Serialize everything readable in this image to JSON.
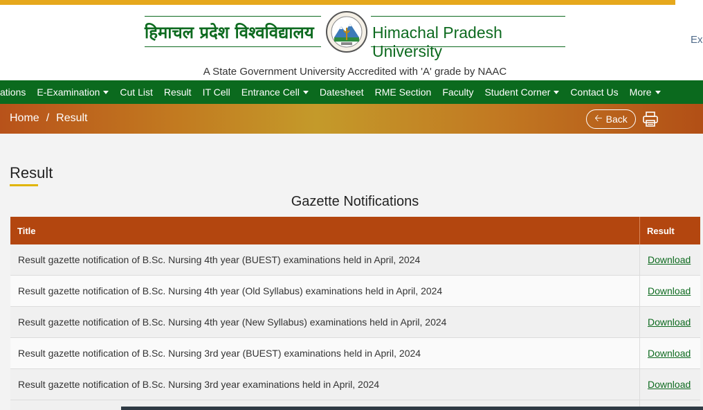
{
  "colors": {
    "brand_green": "#0b6a1e",
    "brand_orange": "#b3460f",
    "gold": "#e6a81c",
    "link_green": "#0d6a1f"
  },
  "header": {
    "hindi_name": "हिमाचल प्रदेश विश्वविद्यालय",
    "english_name": "Himachal Pradesh University",
    "accreditation": "A State Government University Accredited with 'A' grade by NAAC",
    "edge_text": "Ex",
    "emblem_icon": "university-emblem-icon"
  },
  "nav": {
    "items": [
      {
        "label": "ations",
        "dropdown": false
      },
      {
        "label": "E-Examination",
        "dropdown": true
      },
      {
        "label": "Cut List",
        "dropdown": false
      },
      {
        "label": "Result",
        "dropdown": false
      },
      {
        "label": "IT Cell",
        "dropdown": false
      },
      {
        "label": "Entrance Cell",
        "dropdown": true
      },
      {
        "label": "Datesheet",
        "dropdown": false
      },
      {
        "label": "RME Section",
        "dropdown": false
      },
      {
        "label": "Faculty",
        "dropdown": false
      },
      {
        "label": "Student Corner",
        "dropdown": true
      },
      {
        "label": "Contact Us",
        "dropdown": false
      },
      {
        "label": "More",
        "dropdown": true
      }
    ]
  },
  "breadcrumb": {
    "home": "Home",
    "separator": "/",
    "current": "Result",
    "back_label": "Back",
    "back_icon": "arrow-left-icon",
    "print_icon": "printer-icon"
  },
  "main": {
    "page_title": "Result",
    "section_title": "Gazette Notifications",
    "table": {
      "headers": [
        "Title",
        "Result"
      ],
      "rows": [
        {
          "title": "Result  gazette notification of B.Sc.  Nursing 4th year (BUEST) examinations held in April, 2024",
          "link": "Download"
        },
        {
          "title": "Result  gazette notification of B.Sc.  Nursing 4th year (Old Syllabus) examinations held in April, 2024",
          "link": "Download"
        },
        {
          "title": "Result  gazette notification of B.Sc.  Nursing 4th year (New Syllabus) examinations held in April, 2024",
          "link": "Download"
        },
        {
          "title": "Result  gazette notification of B.Sc.  Nursing 3rd year (BUEST) examinations held in April, 2024",
          "link": "Download"
        },
        {
          "title": "Result  gazette notification of B.Sc.  Nursing 3rd year examinations held in April, 2024",
          "link": "Download"
        }
      ]
    }
  }
}
